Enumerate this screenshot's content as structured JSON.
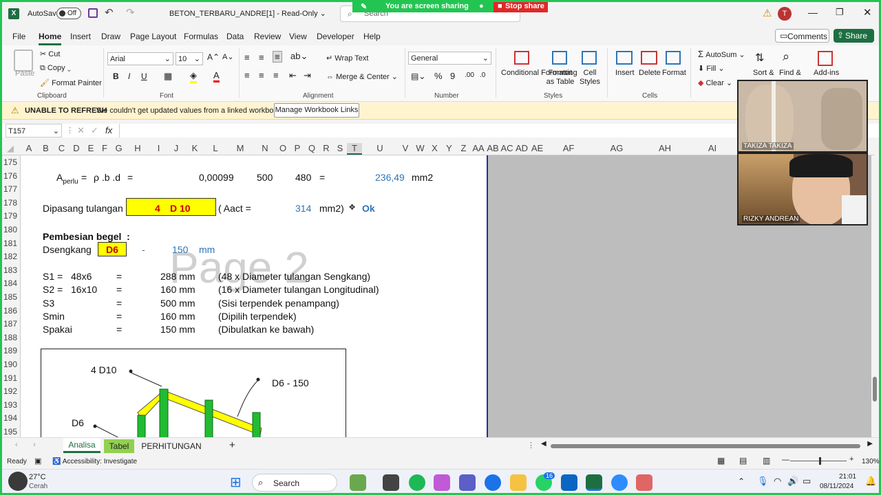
{
  "titlebar": {
    "autosave_label": "AutoSave",
    "autosave_state": "Off",
    "filename": "BETON_TERBARU_ANDRE[1]",
    "mode": "Read-Only",
    "search_placeholder": "Search",
    "sharing_text": "You are screen sharing",
    "stop_share": "Stop share",
    "user_initial": "T"
  },
  "menu": {
    "items": [
      "File",
      "Home",
      "Insert",
      "Draw",
      "Page Layout",
      "Formulas",
      "Data",
      "Review",
      "View",
      "Developer",
      "Help"
    ],
    "comments": "Comments",
    "share": "Share"
  },
  "ribbon": {
    "paste": "Paste",
    "cut": "Cut",
    "copy": "Copy",
    "format_painter": "Format Painter",
    "clipboard": "Clipboard",
    "font_name": "Arial",
    "font_size": "10",
    "font": "Font",
    "bold": "B",
    "italic": "I",
    "underline": "U",
    "wrap_text": "Wrap Text",
    "merge_center": "Merge & Center",
    "alignment": "Alignment",
    "number_format": "General",
    "number": "Number",
    "conditional_formatting": "Conditional Formatting",
    "format_as_table": "Format as Table",
    "cell_styles": "Cell Styles",
    "styles": "Styles",
    "insert": "Insert",
    "delete": "Delete",
    "format": "Format",
    "cells": "Cells",
    "autosum": "AutoSum",
    "fill": "Fill",
    "clear": "Clear",
    "sort": "Sort &",
    "find": "Find &",
    "addins": "Add-ins"
  },
  "infobar": {
    "title": "UNABLE TO REFRESH",
    "message": "We couldn't get updated values from a linked workbook.",
    "button": "Manage Workbook Links"
  },
  "formula": {
    "namebox": "T157",
    "fx": "fx"
  },
  "columns": [
    "A",
    "B",
    "C",
    "D",
    "E",
    "F",
    "G",
    "H",
    "I",
    "J",
    "K",
    "L",
    "M",
    "N",
    "O",
    "P",
    "Q",
    "R",
    "S",
    "T",
    "U",
    "V",
    "W",
    "X",
    "Y",
    "Z",
    "AA",
    "AB",
    "AC",
    "AD",
    "AE",
    "AF",
    "AG",
    "AH",
    "AI"
  ],
  "rows": [
    "175",
    "176",
    "177",
    "178",
    "179",
    "180",
    "181",
    "182",
    "183",
    "184",
    "185",
    "186",
    "187",
    "188",
    "189",
    "190",
    "191",
    "192",
    "193",
    "194",
    "195"
  ],
  "sheet": {
    "watermark": "Page 2",
    "r176": {
      "a": "A",
      "sub": "perlu",
      "eq": "=",
      "formula": "ρ .b .d",
      "eq2": "=",
      "v1": "0,00099",
      "v2": "500",
      "v3": "480",
      "eq3": "=",
      "result": "236,49",
      "unit": "mm2"
    },
    "r178": {
      "label": "Dipasang tulangan",
      "n": "4",
      "bar": "D 10",
      "aact": "( Aact =",
      "val": "314",
      "unit": "mm2)",
      "ok": "Ok"
    },
    "r180": {
      "label": "Pembesian begel",
      "colon": ":"
    },
    "r181": {
      "label": "Dsengkang",
      "dia": "D6",
      "dash": "-",
      "spacing": "150",
      "unit": "mm"
    },
    "calc": [
      {
        "name": "S1 =",
        "expr": "48x6",
        "eq": "=",
        "val": "288 mm",
        "note": "(48 x Diameter tulangan Sengkang)"
      },
      {
        "name": "S2 =",
        "expr": "16x10",
        "eq": "=",
        "val": "160 mm",
        "note": "(16 x Diameter tulangan Longitudinal)"
      },
      {
        "name": "S3",
        "expr": "",
        "eq": "=",
        "val": "500 mm",
        "note": "(Sisi terpendek penampang)"
      },
      {
        "name": "Smin",
        "expr": "",
        "eq": "=",
        "val": "160 mm",
        "note": "(Dipilih terpendek)"
      },
      {
        "name": "Spakai",
        "expr": "",
        "eq": "=",
        "val": "150 mm",
        "note": "(Dibulatkan ke bawah)"
      }
    ],
    "diagram": {
      "top_label": "4  D10",
      "stirrup_label": "D6   -   150",
      "side_label": "D6"
    }
  },
  "video": {
    "p1": "TAKIZA TAKIZA",
    "p2": "RIZKY ANDREAN"
  },
  "tabs": [
    "Analisa",
    "Tabel",
    "PERHITUNGAN"
  ],
  "tab_add": "+",
  "status": {
    "ready": "Ready",
    "accessibility": "Accessibility: Investigate",
    "zoom": "130%"
  },
  "taskbar": {
    "temp": "27°C",
    "weather": "Cerah",
    "search": "Search",
    "badge": "16",
    "time": "21:01",
    "date": "08/11/2024"
  }
}
